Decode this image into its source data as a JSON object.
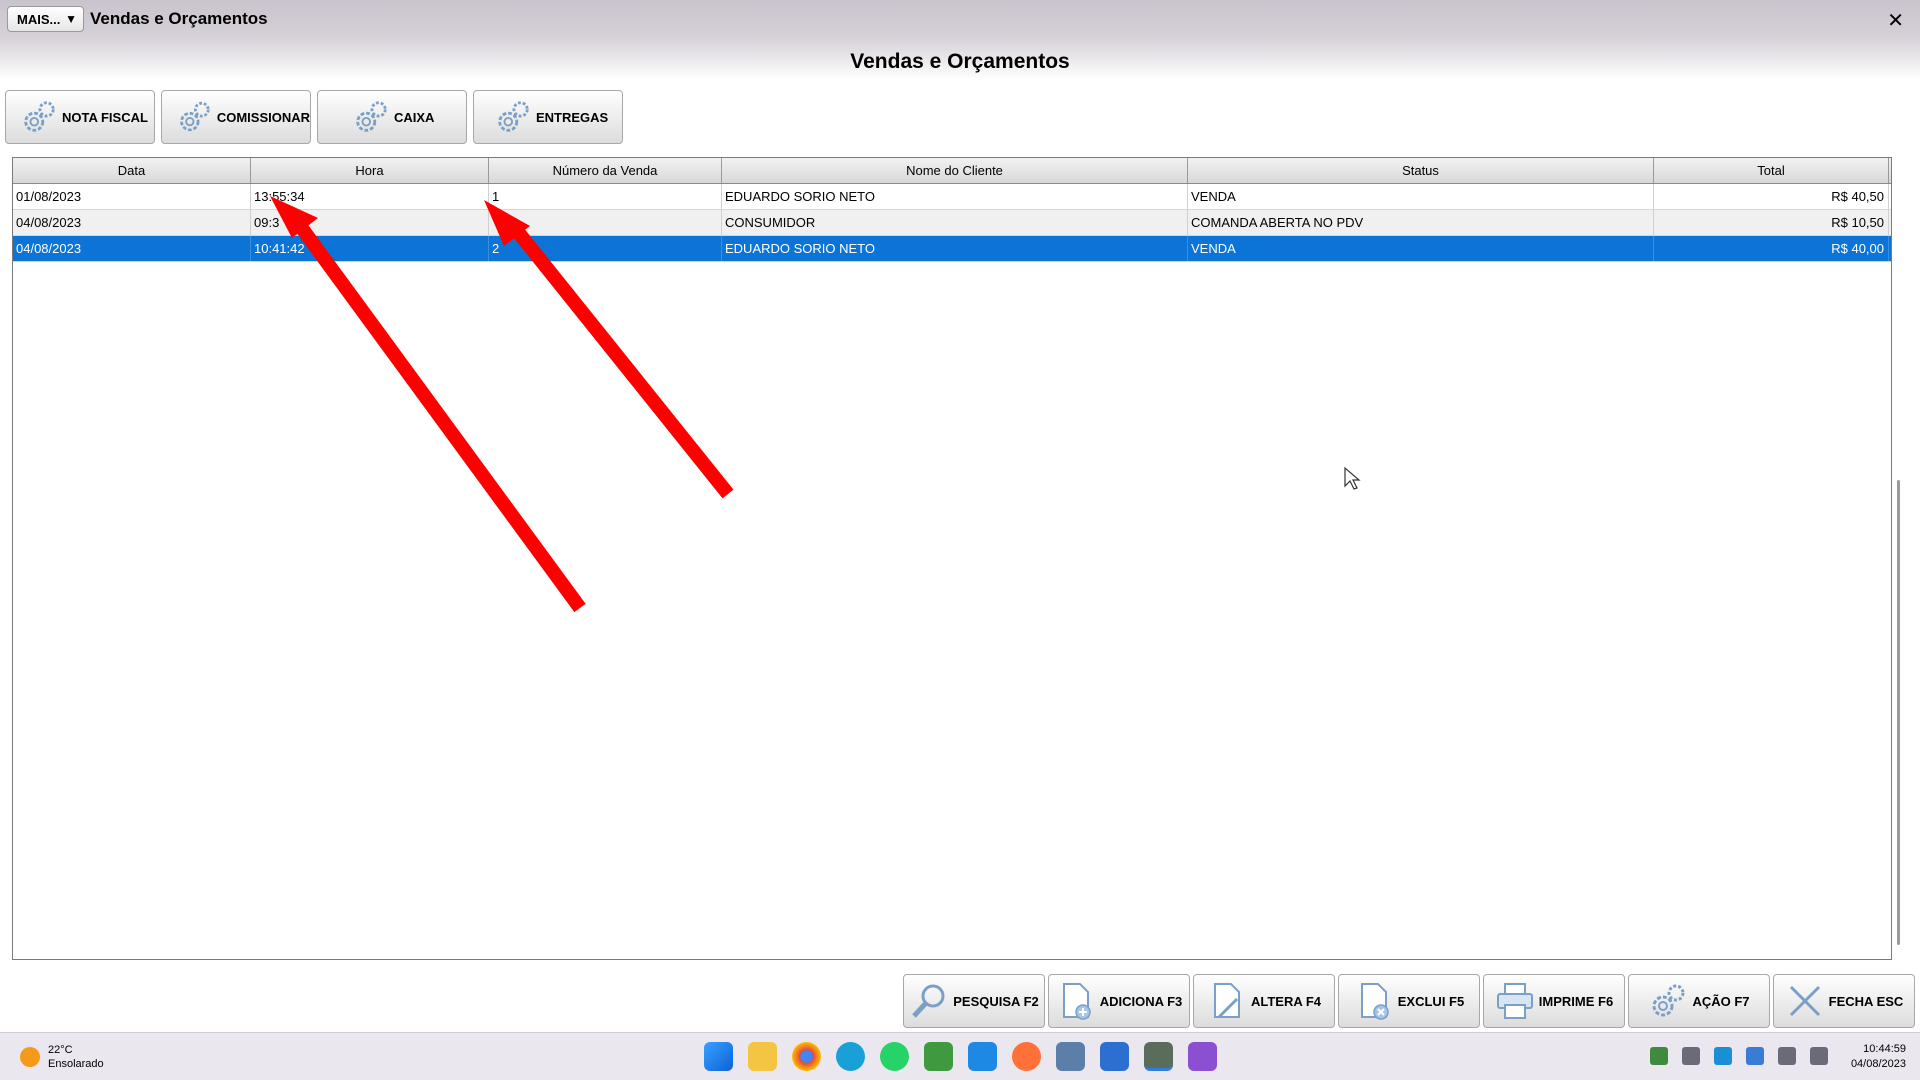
{
  "titlebar": {
    "menu_label": "MAIS...",
    "menu_arrow": "▼",
    "window_title": "Vendas e Orçamentos",
    "close": "✕"
  },
  "page": {
    "title": "Vendas e Orçamentos"
  },
  "top_buttons": [
    "NOTA FISCAL",
    "COMISSIONAR",
    "CAIXA",
    "ENTREGAS"
  ],
  "grid": {
    "columns": [
      "Data",
      "Hora",
      "Número da Venda",
      "Nome do Cliente",
      "Status",
      "Total"
    ],
    "rows": [
      {
        "data": "01/08/2023",
        "hora": "13:55:34",
        "numero": "1",
        "cliente": "EDUARDO SORIO NETO",
        "status": "VENDA",
        "total": "R$ 40,50"
      },
      {
        "data": "04/08/2023",
        "hora": "09:3",
        "numero": "",
        "cliente": "CONSUMIDOR",
        "status": "COMANDA ABERTA NO PDV",
        "total": "R$ 10,50"
      },
      {
        "data": "04/08/2023",
        "hora": "10:41:42",
        "numero": "2",
        "cliente": "EDUARDO SORIO NETO",
        "status": "VENDA",
        "total": "R$ 40,00"
      }
    ]
  },
  "bottom_buttons": {
    "pesquisa": "PESQUISA F2",
    "adiciona": "ADICIONA F3",
    "altera": "ALTERA F4",
    "exclui": "EXCLUI F5",
    "imprime": "IMPRIME F6",
    "acao": "AÇÃO F7",
    "fecha": "FECHA ESC"
  },
  "taskbar": {
    "temperature": "22°C",
    "weather": "Ensolarado",
    "time": "10:44:59",
    "date": "04/08/2023"
  },
  "colors": {
    "selection": "#0b74d6",
    "arrow": "#ff0000"
  }
}
